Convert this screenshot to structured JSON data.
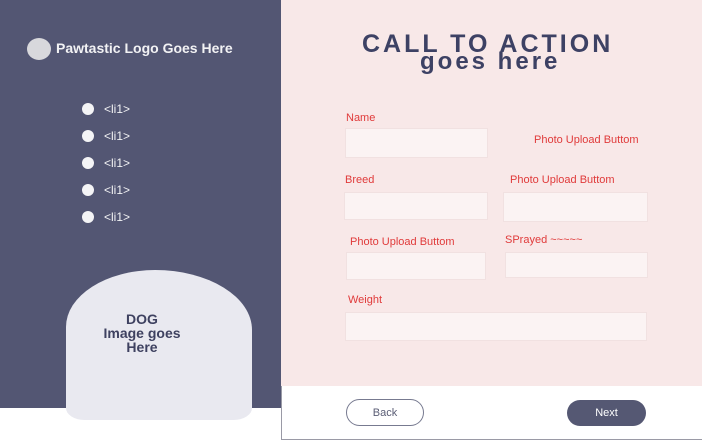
{
  "sidebar": {
    "logo_text": "Pawtastic Logo Goes Here",
    "nav_items": [
      "<li1>",
      "<li1>",
      "<li1>",
      "<li1>",
      "<li1>"
    ],
    "dog_placeholder": [
      "DOG",
      "Image goes",
      "Here"
    ]
  },
  "main": {
    "cta_line1": "CALL TO ACTION",
    "cta_line2": "goes here"
  },
  "form": {
    "name_label": "Name",
    "photo_upload_1": "Photo Upload Buttom",
    "breed_label": "Breed",
    "photo_upload_2": "Photo Upload Buttom",
    "photo_upload_3": "Photo Upload Buttom",
    "spayed_label": "SPrayed ~~~~~",
    "weight_label": "Weight"
  },
  "footer": {
    "back_label": "Back",
    "next_label": "Next"
  }
}
